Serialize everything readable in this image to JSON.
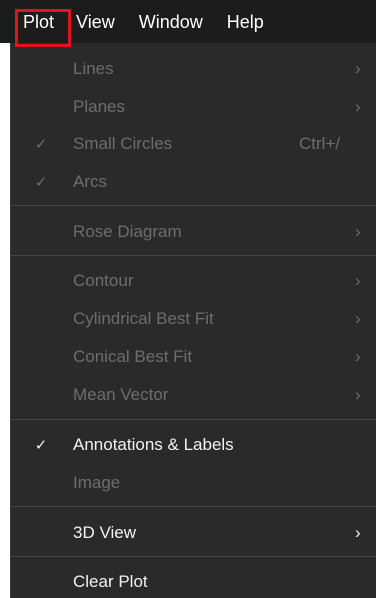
{
  "menubar": {
    "items": [
      {
        "label": "Plot"
      },
      {
        "label": "View"
      },
      {
        "label": "Window"
      },
      {
        "label": "Help"
      }
    ]
  },
  "plot_menu": {
    "items": [
      {
        "label": "Lines",
        "enabled": false,
        "submenu_icon": "chevron-right"
      },
      {
        "label": "Planes",
        "enabled": false,
        "submenu_icon": "chevron-right"
      },
      {
        "label": "Small Circles",
        "enabled": false,
        "checked": true,
        "shortcut": "Ctrl+/"
      },
      {
        "label": "Arcs",
        "enabled": false,
        "checked": true
      },
      {
        "label": "Rose Diagram",
        "enabled": false,
        "submenu_icon": "chevron-right"
      },
      {
        "label": "Contour",
        "enabled": false,
        "submenu_icon": "chevron-right"
      },
      {
        "label": "Cylindrical Best Fit",
        "enabled": false,
        "submenu_icon": "chevron-right"
      },
      {
        "label": "Conical Best Fit",
        "enabled": false,
        "submenu_icon": "chevron-right"
      },
      {
        "label": "Mean Vector",
        "enabled": false,
        "submenu_icon": "chevron-right"
      },
      {
        "label": "Annotations & Labels",
        "enabled": true,
        "checked": true
      },
      {
        "label": "Image",
        "enabled": false
      },
      {
        "label": "3D View",
        "enabled": true,
        "submenu_icon": "chevron-right"
      },
      {
        "label": "Clear Plot",
        "enabled": true
      }
    ]
  },
  "glyphs": {
    "check": "✓",
    "chevron": "›"
  },
  "colors": {
    "menubar_bg": "#1c1c1c",
    "menu_bg": "#2a2a2a",
    "enabled_text": "#f2f2f2",
    "disabled_text": "#6d6d6d",
    "highlight": "#e3121c"
  }
}
